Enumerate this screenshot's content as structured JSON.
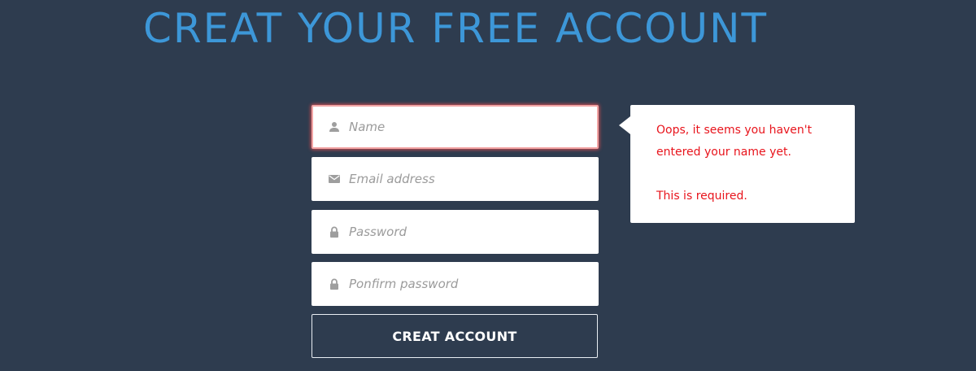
{
  "page": {
    "title": "CREAT YOUR FREE ACCOUNT"
  },
  "form": {
    "fields": [
      {
        "name": "name",
        "icon": "user-icon",
        "placeholder": "Name",
        "value": "",
        "state": "error"
      },
      {
        "name": "email",
        "icon": "envelope-icon",
        "placeholder": "Email address",
        "value": "",
        "state": "normal"
      },
      {
        "name": "password",
        "icon": "lock-icon",
        "placeholder": "Password",
        "value": "",
        "state": "normal"
      },
      {
        "name": "confirm-password",
        "icon": "lock-icon",
        "placeholder": "Ponfirm password",
        "value": "",
        "state": "normal"
      }
    ],
    "submit_label": "CREAT ACCOUNT"
  },
  "validation": {
    "message_line1": "Oops, it seems you haven't",
    "message_line2": "entered your name yet.",
    "message_line3": "This is required."
  },
  "colors": {
    "background": "#2e3c4f",
    "title": "#3d97d8",
    "error_text": "#e8141c",
    "error_glow": "#ff5050",
    "icon": "#9e9e9e",
    "button_border": "#e9eef3"
  }
}
